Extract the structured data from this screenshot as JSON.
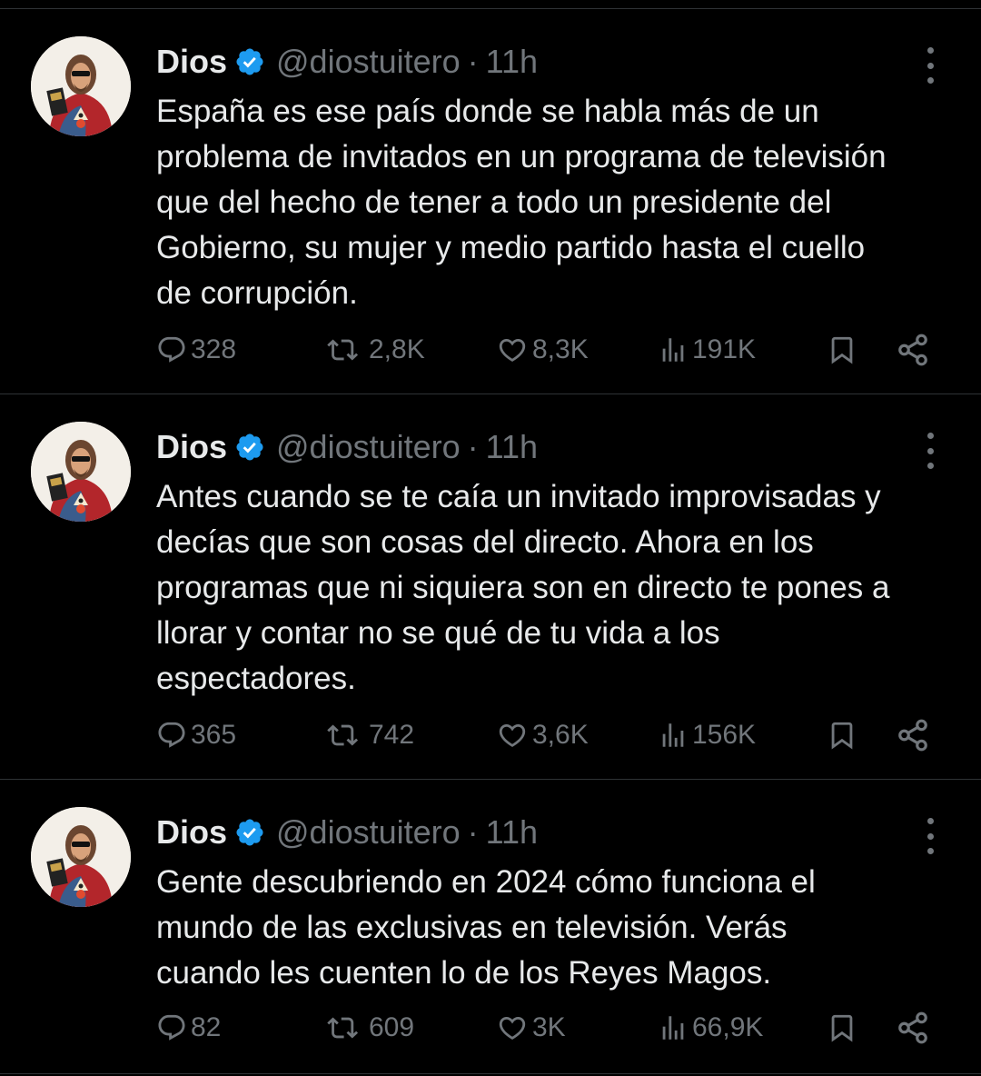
{
  "tweets": [
    {
      "author": {
        "name": "Dios",
        "handle": "@diostuitero",
        "verified": true
      },
      "separator": "·",
      "time": "11h",
      "text": "España es ese país donde se habla más de un\nproblema de invitados en un programa de televisión\nque del hecho de tener a todo un presidente del\nGobierno, su mujer y medio partido hasta el cuello\nde corrupción.",
      "stats": {
        "replies": "328",
        "reposts": "2,8K",
        "likes": "8,3K",
        "views": "191K"
      }
    },
    {
      "author": {
        "name": "Dios",
        "handle": "@diostuitero",
        "verified": true
      },
      "separator": "·",
      "time": "11h",
      "text": "Antes cuando se te caía un invitado improvisadas y\ndecías que son cosas del directo. Ahora en los\nprogramas que ni siquiera son en directo te pones a\nllorar y contar no se qué de tu vida a los\nespectadores.",
      "stats": {
        "replies": "365",
        "reposts": "742",
        "likes": "3,6K",
        "views": "156K"
      }
    },
    {
      "author": {
        "name": "Dios",
        "handle": "@diostuitero",
        "verified": true
      },
      "separator": "·",
      "time": "11h",
      "text": "Gente descubriendo en 2024 cómo funciona el\nmundo de las exclusivas en televisión. Verás\ncuando les cuenten lo de los Reyes Magos.",
      "stats": {
        "replies": "82",
        "reposts": "609",
        "likes": "3K",
        "views": "66,9K"
      }
    }
  ],
  "colors": {
    "background": "#000000",
    "text": "#e7e9ea",
    "secondary": "#71767b",
    "divider": "#2f3336",
    "verified_badge": "#1d9bf0"
  },
  "icons": [
    "verified-badge-icon",
    "more-icon",
    "reply-icon",
    "repost-icon",
    "like-icon",
    "views-icon",
    "bookmark-icon",
    "share-icon"
  ]
}
